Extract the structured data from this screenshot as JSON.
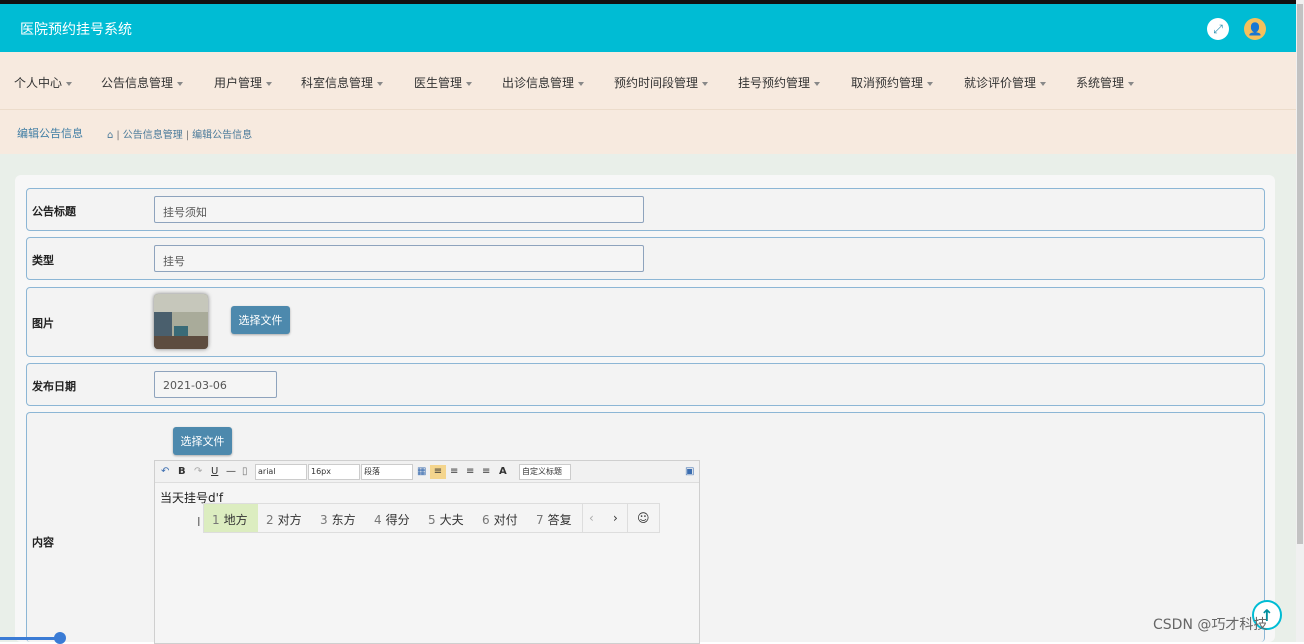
{
  "app_title": "医院预约挂号系统",
  "header": {
    "fullscreen_icon": "expand-icon",
    "user_icon": "user-icon"
  },
  "nav": [
    "个人中心",
    "公告信息管理",
    "用户管理",
    "科室信息管理",
    "医生管理",
    "出诊信息管理",
    "预约时间段管理",
    "挂号预约管理",
    "取消预约管理",
    "就诊评价管理",
    "系统管理"
  ],
  "page_title": "编辑公告信息",
  "breadcrumb": [
    "公告信息管理",
    "编辑公告信息"
  ],
  "form": {
    "title_label": "公告标题",
    "title_value": "挂号须知",
    "type_label": "类型",
    "type_value": "挂号",
    "image_label": "图片",
    "choose_file": "选择文件",
    "date_label": "发布日期",
    "date_value": "2021-03-06",
    "content_label": "内容",
    "content_choose_file": "选择文件"
  },
  "editor": {
    "font_name": "arial",
    "font_size": "16px",
    "paragraph": "段落",
    "custom_title": "自定义标题",
    "text": "当天挂号d'f"
  },
  "ime": {
    "candidates": [
      {
        "n": "1",
        "t": "地方"
      },
      {
        "n": "2",
        "t": "对方"
      },
      {
        "n": "3",
        "t": "东方"
      },
      {
        "n": "4",
        "t": "得分"
      },
      {
        "n": "5",
        "t": "大夫"
      },
      {
        "n": "6",
        "t": "对付"
      },
      {
        "n": "7",
        "t": "答复"
      }
    ]
  },
  "watermark": "CSDN @巧才科技",
  "colors": {
    "header": "#00bcd4",
    "nav_bg": "#f7eadf",
    "button": "#4d89ad",
    "accent": "#8cb6d5"
  }
}
